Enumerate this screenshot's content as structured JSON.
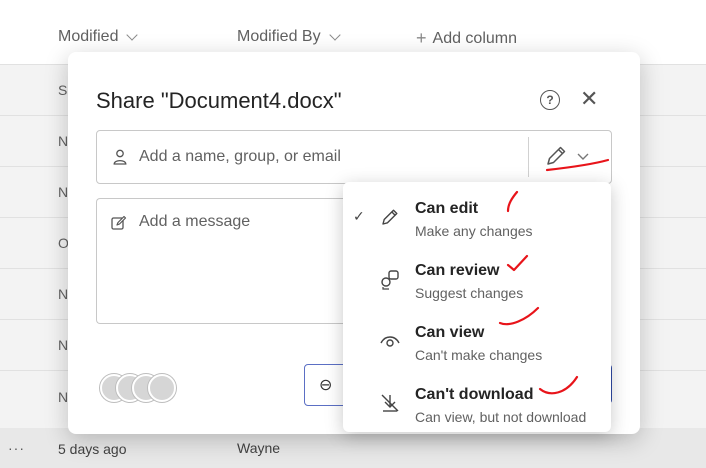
{
  "list": {
    "columns": [
      {
        "label": "Modified"
      },
      {
        "label": "Modified By"
      },
      {
        "label": "Add column"
      }
    ],
    "row_letters": [
      "S",
      "N",
      "N",
      "O",
      "N",
      "N",
      "N"
    ],
    "bottom_row": {
      "more": "···",
      "modified": "5 days ago",
      "modified_by": "Wayne"
    }
  },
  "dialog": {
    "title": "Share \"Document4.docx\"",
    "help": "?",
    "close": "✕",
    "name_placeholder": "Add a name, group, or email",
    "message_placeholder": "Add a message"
  },
  "permissions_menu": {
    "items": [
      {
        "title": "Can edit",
        "description": "Make any changes",
        "icon": "pencil-icon",
        "selected": true
      },
      {
        "title": "Can review",
        "description": "Suggest changes",
        "icon": "review-icon",
        "selected": false
      },
      {
        "title": "Can view",
        "description": "Can't make changes",
        "icon": "eye-icon",
        "selected": false
      },
      {
        "title": "Can't download",
        "description": "Can view, but not download",
        "icon": "no-download-icon",
        "selected": false
      }
    ]
  },
  "colors": {
    "annotation": "#e8141a",
    "accent": "#2f4aa6"
  }
}
